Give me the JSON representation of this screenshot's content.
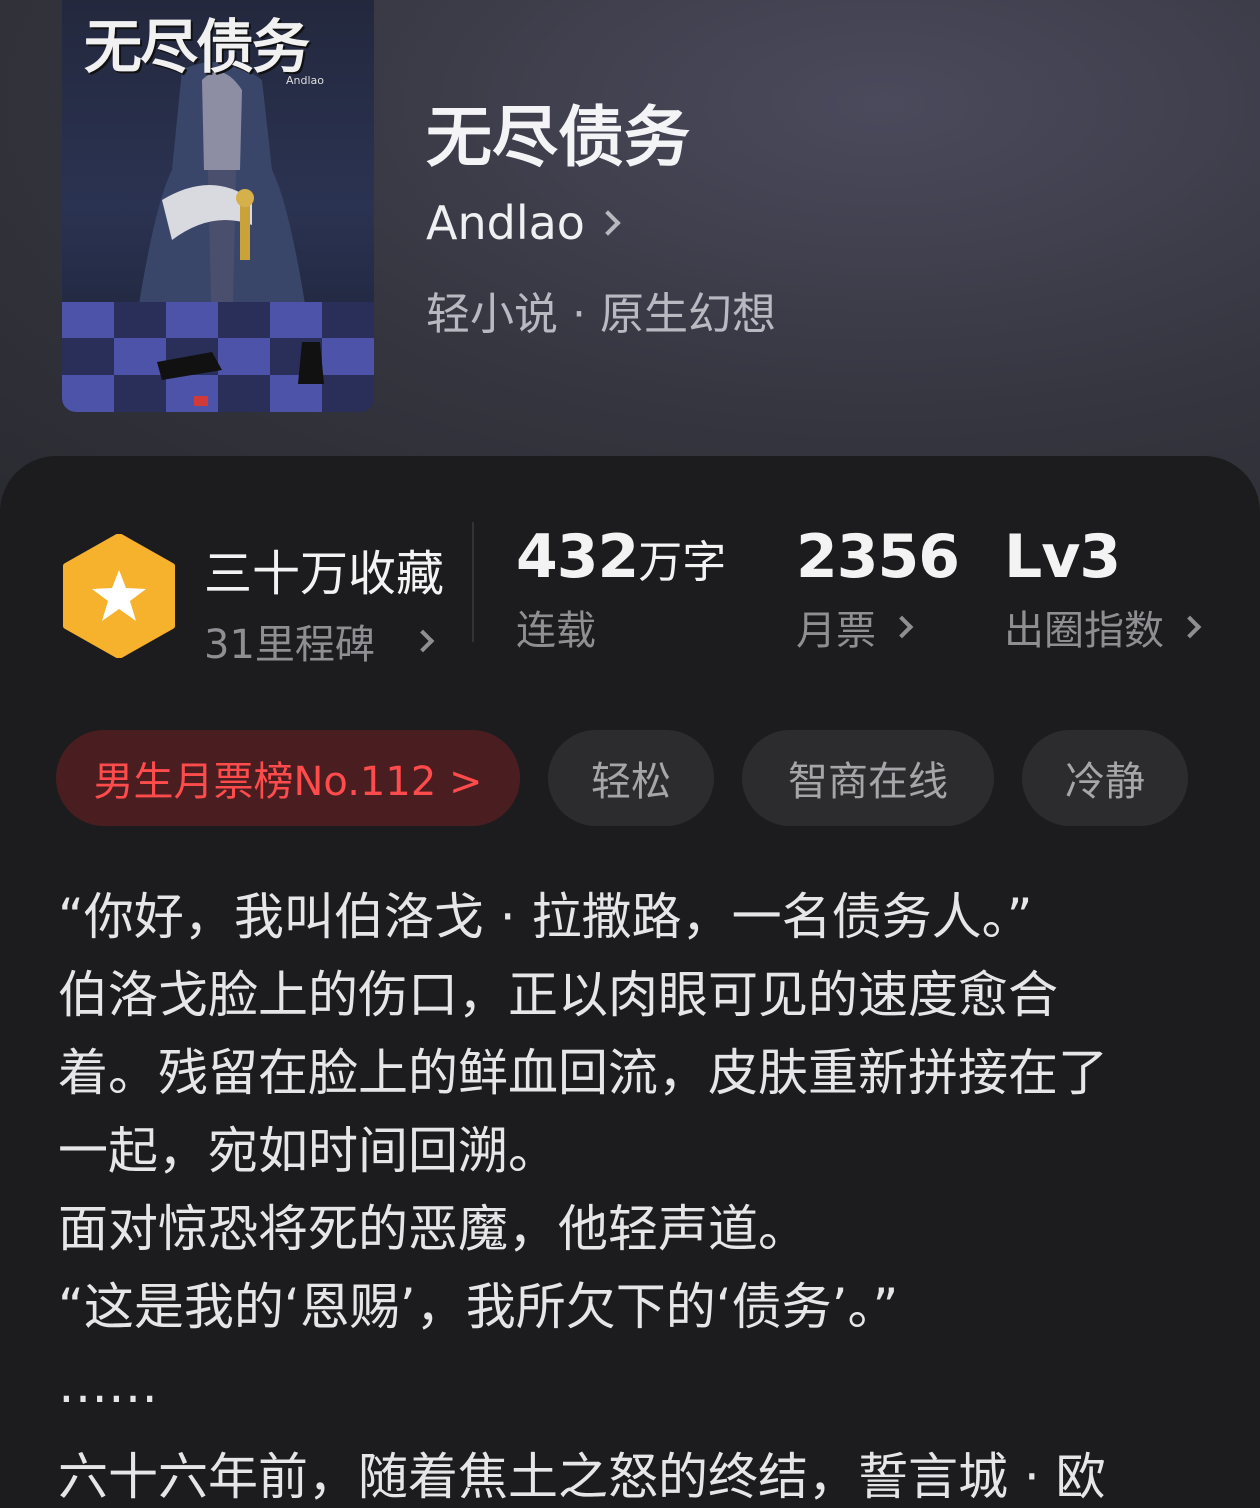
{
  "book": {
    "cover_title": "无尽债务",
    "cover_author": "Andlao",
    "title": "无尽债务",
    "author": "Andlao",
    "genre": "轻小说 · 原生幻想"
  },
  "stats": {
    "collect": {
      "main": "三十万收藏",
      "sub": "31里程碑"
    },
    "words": {
      "number": "432",
      "unit": "万字",
      "sub": "连载"
    },
    "tickets": {
      "number": "2356",
      "sub": "月票"
    },
    "level": {
      "number": "Lv3",
      "sub": "出圈指数"
    }
  },
  "tags": [
    "男生月票榜No.112 >",
    "轻松",
    "智商在线",
    "冷静"
  ],
  "description": [
    "“你好，我叫伯洛戈 · 拉撒路，一名债务人。”",
    "伯洛戈脸上的伤口，正以肉眼可见的速度愈合",
    "着。残留在脸上的鲜血回流，皮肤重新拼接在了",
    "一起，宛如时间回溯。",
    "面对惊恐将死的恶魔，他轻声道。",
    "“这是我的‘恩赐’，我所欠下的‘债务’。”",
    "……",
    "六十六年前，随着焦土之怒的终结，誓言城 · 欧"
  ],
  "colors": {
    "badge": "#f6b12d",
    "rank_text": "#ff4b4b",
    "rank_bg": "#4a1e20",
    "panel_bg": "#1c1c1e"
  }
}
